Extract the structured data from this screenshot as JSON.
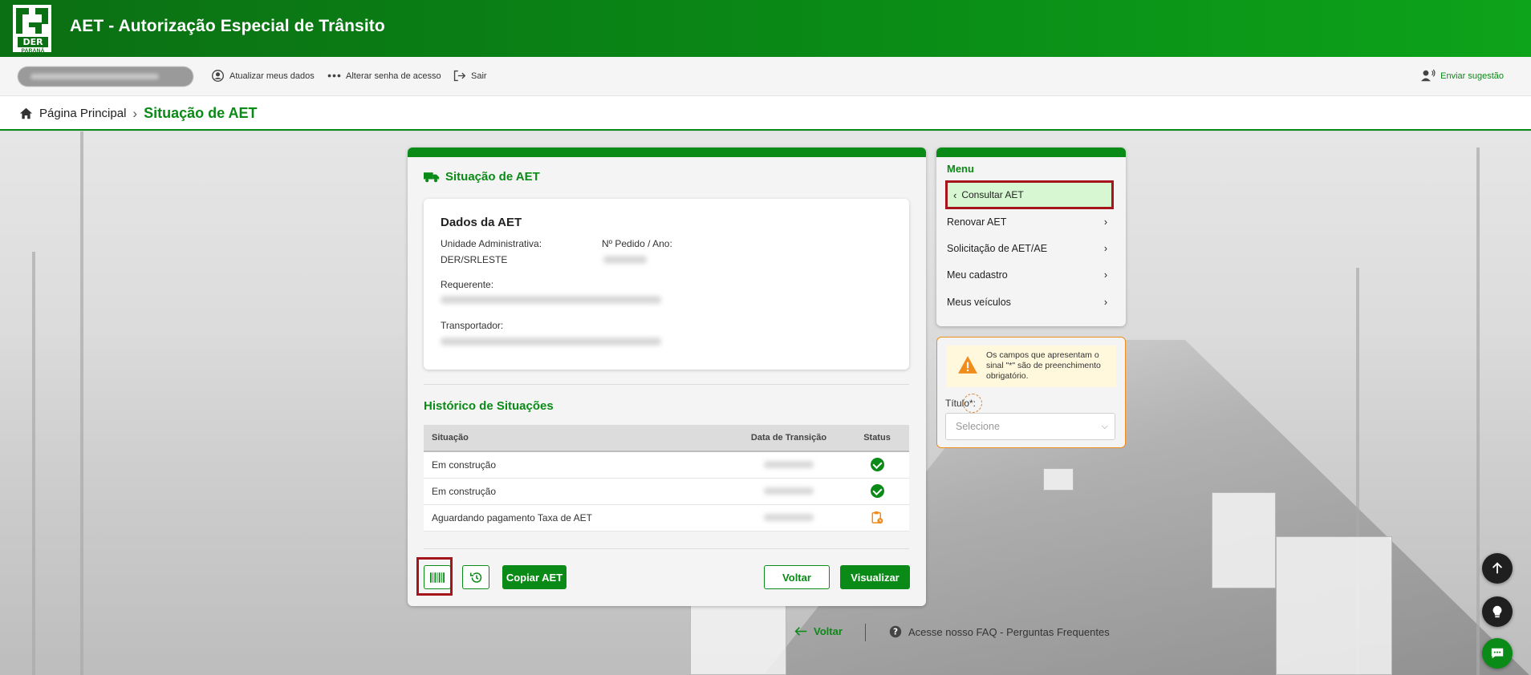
{
  "header": {
    "title": "AET - Autorização Especial de Trânsito",
    "logo_text": "DER",
    "logo_subtext": "PARANÁ"
  },
  "userbar": {
    "update_data": "Atualizar meus dados",
    "change_password": "Alterar senha de acesso",
    "logout": "Sair",
    "suggestion": "Enviar sugestão"
  },
  "breadcrumb": {
    "home": "Página Principal",
    "separator": "›",
    "current": "Situação de AET"
  },
  "main": {
    "title": "Situação de AET",
    "dados": {
      "heading": "Dados da AET",
      "unidade_label": "Unidade Administrativa:",
      "unidade_value": "DER/SRLESTE",
      "pedido_label": "Nº Pedido / Ano:",
      "requerente_label": "Requerente:",
      "transportador_label": "Transportador:"
    },
    "historico": {
      "title": "Histórico de Situações",
      "columns": [
        "Situação",
        "Data de Transição",
        "Status"
      ],
      "rows": [
        {
          "situacao": "Em construção",
          "status": "ok"
        },
        {
          "situacao": "Em construção",
          "status": "ok"
        },
        {
          "situacao": "Aguardando pagamento Taxa de AET",
          "status": "pending"
        }
      ]
    },
    "buttons": {
      "copy": "Copiar AET",
      "back": "Voltar",
      "view": "Visualizar"
    }
  },
  "menu": {
    "title": "Menu",
    "active": "Consultar AET",
    "items": [
      "Renovar AET",
      "Solicitação de AET/AE",
      "Meu cadastro",
      "Meus veículos"
    ]
  },
  "form": {
    "note": "Os campos que apresentam o sinal \"*\" são de preenchimento obrigatório.",
    "titulo_label": "Título*:",
    "select_placeholder": "Selecione"
  },
  "footer": {
    "back": "Voltar",
    "faq": "Acesse nosso FAQ - Perguntas Frequentes"
  },
  "colors": {
    "brand_green": "#0a8a16",
    "highlight_red": "#a5151b",
    "warning_orange": "#f08c1c"
  }
}
